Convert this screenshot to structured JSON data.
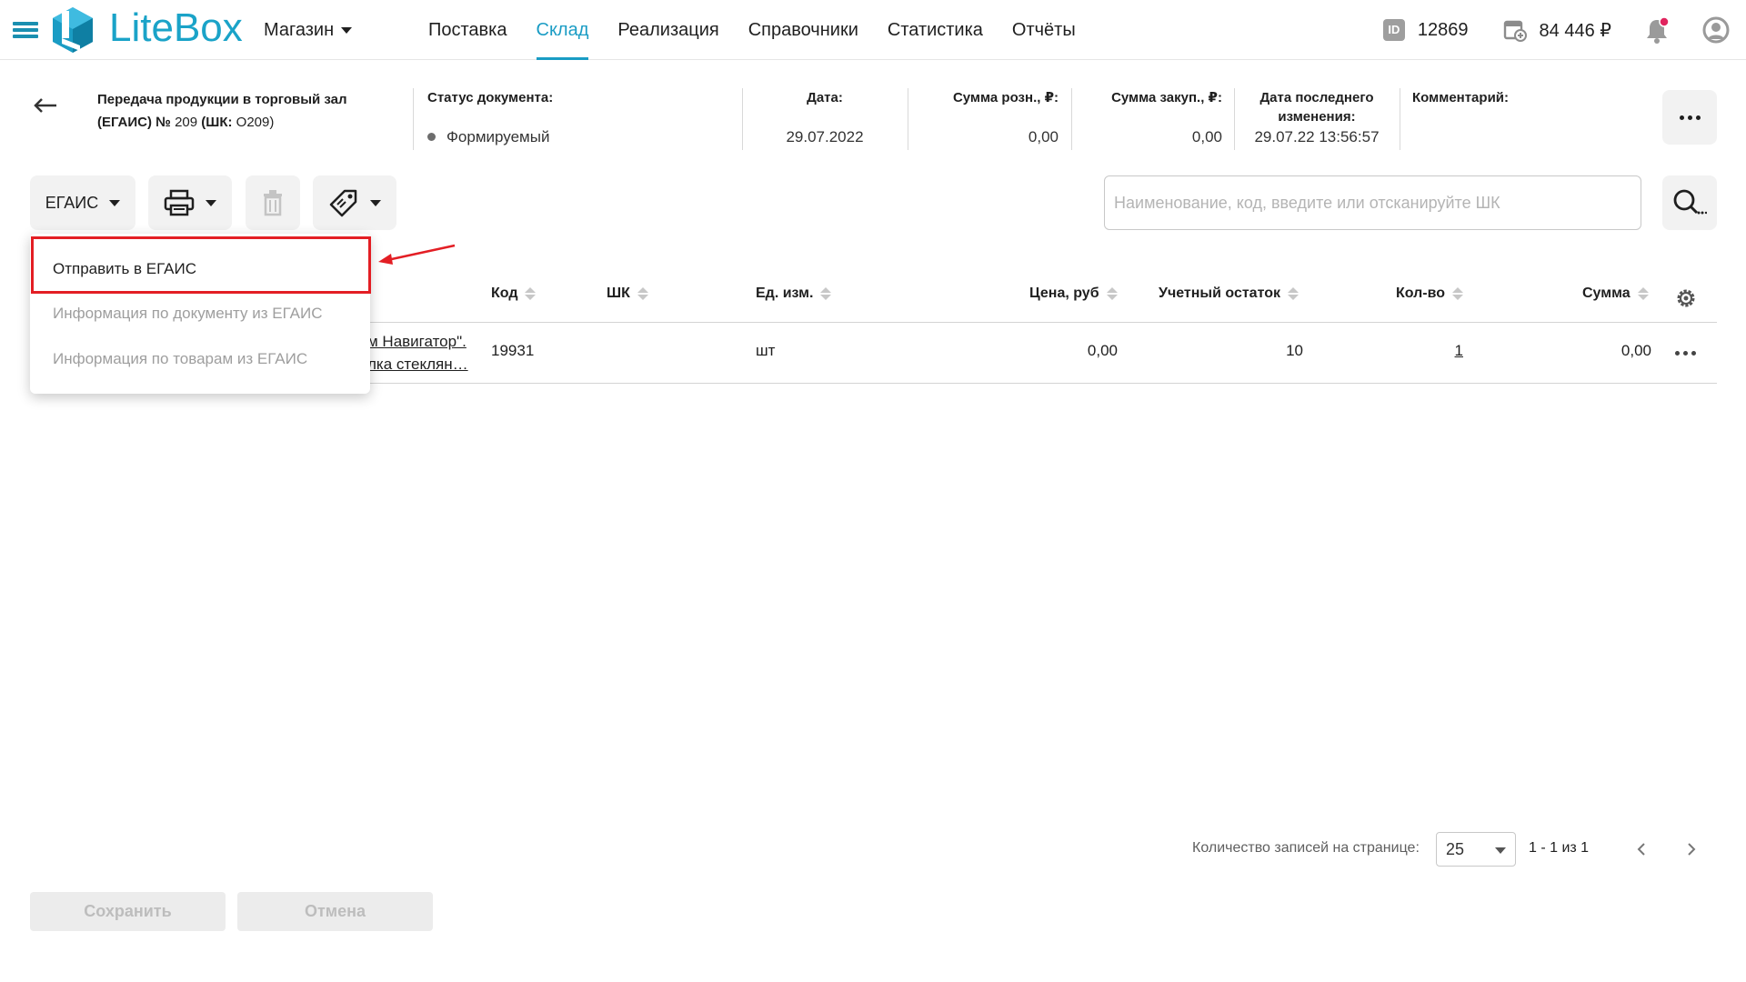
{
  "app": {
    "logo_text": "LiteBox",
    "store_label": "Магазин",
    "accent_color": "#1a9cc4"
  },
  "nav": {
    "items": [
      {
        "label": "Поставка",
        "active": false
      },
      {
        "label": "Склад",
        "active": true
      },
      {
        "label": "Реализация",
        "active": false
      },
      {
        "label": "Справочники",
        "active": false
      },
      {
        "label": "Статистика",
        "active": false
      },
      {
        "label": "Отчёты",
        "active": false
      }
    ]
  },
  "header_right": {
    "id_icon_text": "ID",
    "id_value": "12869",
    "balance": "84 446 ₽"
  },
  "document": {
    "title_part1": "Передача продукции в торговый зал (ЕГАИС) №",
    "title_number": "209",
    "title_code_label": "(ШК:",
    "title_code": "О209)",
    "status_label": "Статус документа:",
    "status_value": "Формируемый",
    "date_label": "Дата:",
    "date_value": "29.07.2022",
    "retail_sum_label": "Сумма розн., ₽:",
    "retail_sum_value": "0,00",
    "purchase_sum_label": "Сумма закуп., ₽:",
    "purchase_sum_value": "0,00",
    "last_change_label": "Дата последнего изменения:",
    "last_change_value": "29.07.22 13:56:57",
    "comment_label": "Комментарий:"
  },
  "toolbar": {
    "egais_label": "ЕГАИС",
    "search_placeholder": "Наименование, код, введите или отсканируйте ШК"
  },
  "dropdown": {
    "items": [
      {
        "label": "Отправить в ЕГАИС",
        "enabled": true
      },
      {
        "label": "Информация по документу из ЕГАИС",
        "enabled": false
      },
      {
        "label": "Информация по товарам из ЕГАИС",
        "enabled": false
      }
    ],
    "highlight_color": "#e31e24"
  },
  "table": {
    "columns": [
      "Код",
      "ШК",
      "Ед. изм.",
      "Цена, руб",
      "Учетный остаток",
      "Кол-во",
      "Сумма"
    ],
    "rows": [
      {
        "name_line1": "м Навигатор\".",
        "name_line2": "лка стеклян…",
        "code": "19931",
        "barcode": "",
        "unit": "шт",
        "price": "0,00",
        "stock": "10",
        "qty": "1",
        "sum": "0,00"
      }
    ]
  },
  "pagination": {
    "per_page_label": "Количество записей на странице:",
    "per_page_value": "25",
    "range": "1 - 1 из 1"
  },
  "footer": {
    "save_label": "Сохранить",
    "cancel_label": "Отмена"
  }
}
